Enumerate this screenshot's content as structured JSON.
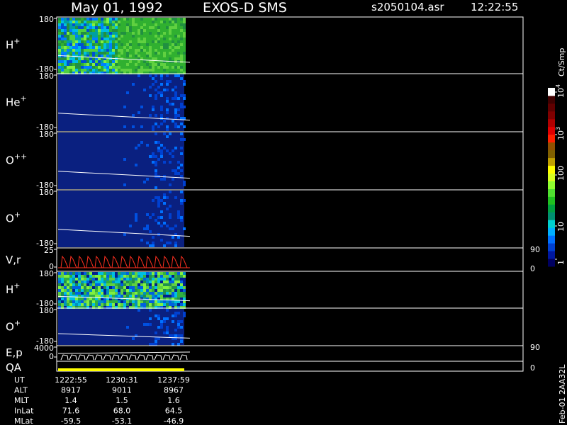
{
  "header": {
    "date": "May 01, 1992",
    "instrument": "EXOS-D SMS",
    "file": "s2050104.asr",
    "time": "12:22:55"
  },
  "panels": [
    {
      "id": "h_plus",
      "label": "H",
      "sup": "+",
      "ytop": "180",
      "ybot": "-180"
    },
    {
      "id": "he_plus",
      "label": "He",
      "sup": "+",
      "ytop": "180",
      "ybot": "-180"
    },
    {
      "id": "o_plusplus",
      "label": "O",
      "sup": "++",
      "ytop": "180",
      "ybot": "-180"
    },
    {
      "id": "o_plus",
      "label": "O",
      "sup": "+",
      "ytop": "180",
      "ybot": "-180"
    },
    {
      "id": "vr",
      "label": "V,r",
      "sup": "",
      "ytop": "25",
      "ybot": "0",
      "rtop": "90",
      "rbot": "0"
    },
    {
      "id": "h_plus_2",
      "label": "H",
      "sup": "+",
      "ytop": "180",
      "ybot": "-180"
    },
    {
      "id": "o_plus_2",
      "label": "O",
      "sup": "+",
      "ytop": "180",
      "ybot": "-180"
    },
    {
      "id": "ep",
      "label": "E,p",
      "sup": "",
      "ytop": "4000",
      "ybot": "0",
      "rtop": "90",
      "rbot": "0"
    },
    {
      "id": "qa",
      "label": "QA",
      "sup": "",
      "ytop": "",
      "ybot": ""
    }
  ],
  "colorbar": {
    "unit": "Ct/Smp",
    "ticks": [
      {
        "base": "1",
        "exp": ""
      },
      {
        "base": "10",
        "exp": ""
      },
      {
        "base": "100",
        "exp": ""
      },
      {
        "base": "10",
        "exp": "3"
      },
      {
        "base": "10",
        "exp": "4"
      }
    ],
    "colors": [
      "#000060",
      "#0018a0",
      "#0040d0",
      "#0070ff",
      "#00b0ff",
      "#00d0d0",
      "#009070",
      "#00a040",
      "#20c020",
      "#50e030",
      "#90ff30",
      "#d8ff20",
      "#ffff00",
      "#c0a000",
      "#806000",
      "#905000",
      "#ff2000",
      "#e00000",
      "#b00000",
      "#800000",
      "#600000",
      "#400000",
      "#ffffff"
    ]
  },
  "footer": {
    "rows": [
      {
        "label": "UT",
        "values": [
          "1222:55",
          "1230:31",
          "1237:59"
        ]
      },
      {
        "label": "ALT",
        "values": [
          "8917",
          "9011",
          "8967"
        ]
      },
      {
        "label": "MLT",
        "values": [
          "1.4",
          "1.5",
          "1.6"
        ]
      },
      {
        "label": "InLat",
        "values": [
          "71.6",
          "68.0",
          "64.5"
        ]
      },
      {
        "label": "MLat",
        "values": [
          "-59.5",
          "-53.1",
          "-46.9"
        ]
      }
    ],
    "stamp": "Feb-01 2AA32L"
  },
  "chart_data": {
    "type": "heatmap",
    "title": "May 01, 1992   EXOS-D SMS",
    "x": {
      "label": "UT",
      "ticks": [
        "1222:55",
        "1230:31",
        "1237:59"
      ]
    },
    "panels": [
      "H+",
      "He+",
      "O++",
      "O+",
      "V,r",
      "H+",
      "O+",
      "E,p",
      "QA"
    ],
    "ylim_pitch": [
      -180,
      180
    ],
    "ylim_vr": [
      0,
      25
    ],
    "ylim_ep": [
      0,
      4000
    ],
    "colorbar": {
      "label": "Ct/Smp",
      "scale": "log",
      "range": [
        1,
        10000
      ]
    }
  }
}
